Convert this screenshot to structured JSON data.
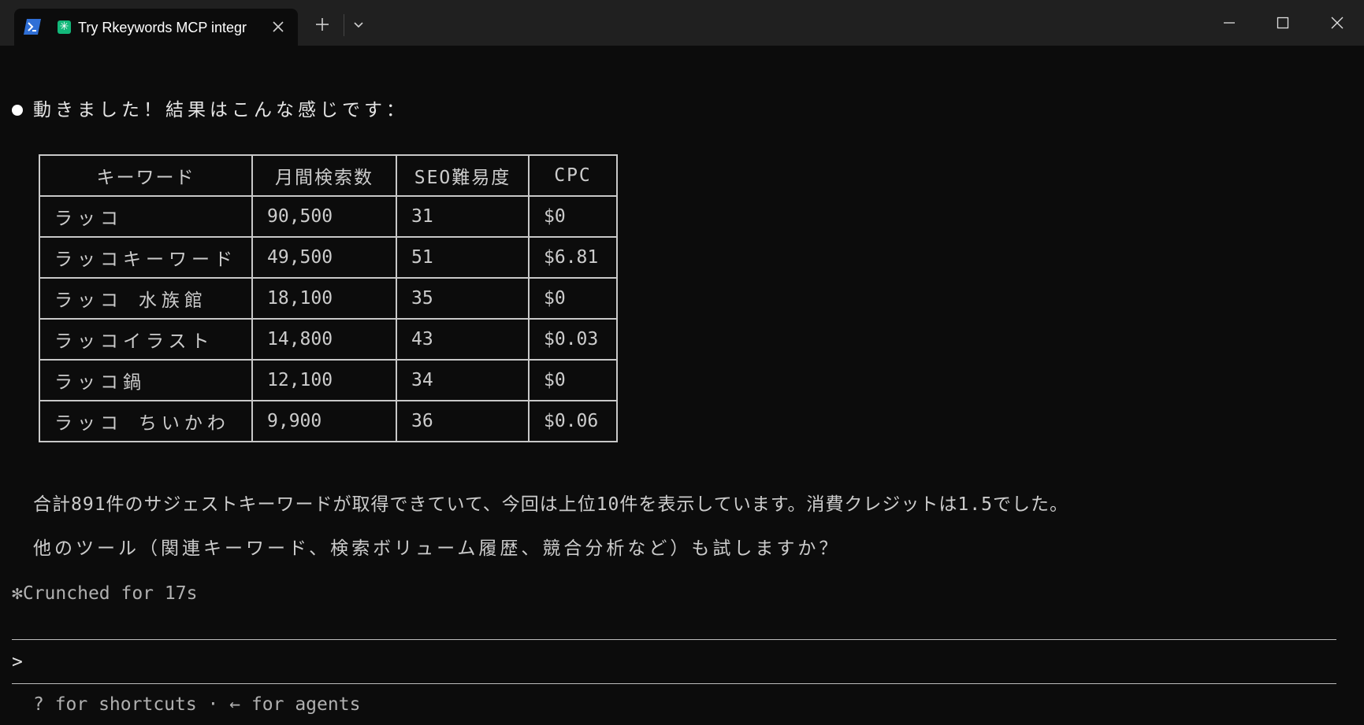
{
  "window": {
    "tab_title": "Try Rkeywords MCP integr",
    "tab_icons": [
      "powershell-icon",
      "asterisk-app-icon"
    ],
    "controls": [
      "minimize-icon",
      "maximize-icon",
      "close-icon"
    ]
  },
  "message": {
    "heading": "動きました！結果はこんな感じです：",
    "table": {
      "headers": [
        "キーワード",
        "月間検索数",
        "SEO難易度",
        "CPC"
      ],
      "rows": [
        [
          "ラッコ",
          "90,500",
          "31",
          "$0"
        ],
        [
          "ラッコキーワード",
          "49,500",
          "51",
          "$6.81"
        ],
        [
          "ラッコ 水族館",
          "18,100",
          "35",
          "$0"
        ],
        [
          "ラッコイラスト",
          "14,800",
          "43",
          "$0.03"
        ],
        [
          "ラッコ鍋",
          "12,100",
          "34",
          "$0"
        ],
        [
          "ラッコ ちいかわ",
          "9,900",
          "36",
          "$0.06"
        ]
      ]
    },
    "summary": "合計891件のサジェストキーワードが取得できていて、今回は上位10件を表示しています。消費クレジットは1.5でした。",
    "question": "他のツール（関連キーワード、検索ボリューム履歴、競合分析など）も試しますか？"
  },
  "status": {
    "symbol": "✻",
    "text": "Crunched for 17s"
  },
  "prompt": {
    "char": ">"
  },
  "hint": "? for shortcuts · ← for agents"
}
